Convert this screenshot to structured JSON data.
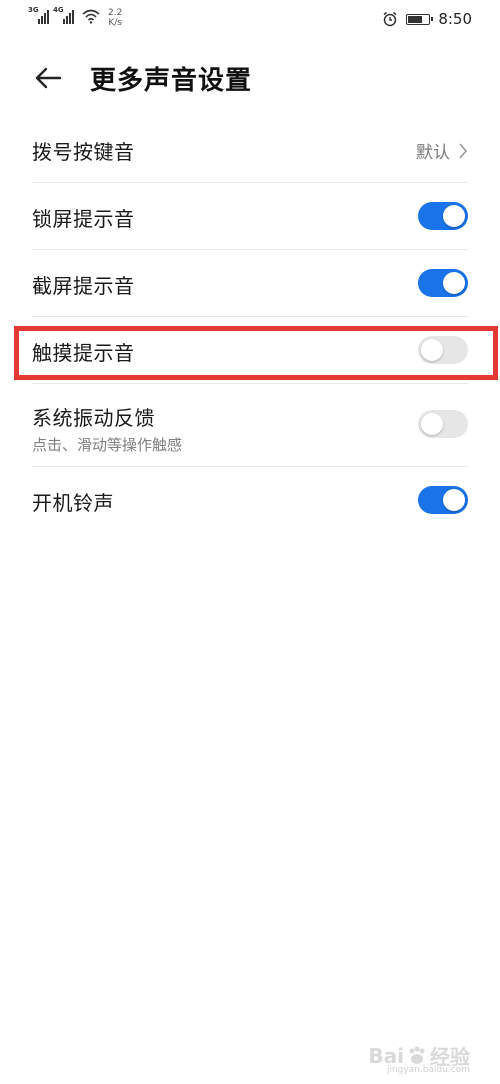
{
  "status_bar": {
    "signal1_tag": "3G",
    "signal2_tag": "4G",
    "net_speed_value": "2.2",
    "net_speed_unit": "K/s",
    "time": "8:50",
    "icons": [
      "signal-icon",
      "signal-icon",
      "wifi-icon",
      "alarm-icon",
      "battery-icon"
    ]
  },
  "header": {
    "back_icon": "arrow-left-icon",
    "title": "更多声音设置"
  },
  "settings": {
    "dial_tone": {
      "label": "拨号按键音",
      "value": "默认"
    },
    "lock_screen": {
      "label": "锁屏提示音",
      "enabled": true
    },
    "screenshot": {
      "label": "截屏提示音",
      "enabled": true
    },
    "touch": {
      "label": "触摸提示音",
      "enabled": false
    },
    "vibration": {
      "label": "系统振动反馈",
      "sub": "点击、滑动等操作触感",
      "enabled": false
    },
    "boot_ringtone": {
      "label": "开机铃声",
      "enabled": true
    }
  },
  "colors": {
    "toggle_on": "#1a73e8",
    "toggle_off": "#e6e6e6",
    "highlight_border": "#e33b34"
  },
  "watermark": {
    "brand": "Bai",
    "text": "经验",
    "sub": "jingyan.baidu.com"
  }
}
